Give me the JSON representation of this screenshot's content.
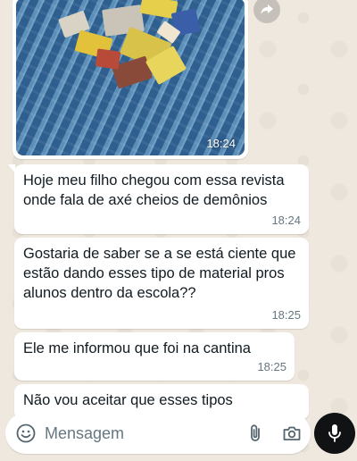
{
  "messages": [
    {
      "text": "Hoje meu filho chegou com essa revista onde fala de axé cheios de demônios",
      "time": "18:24"
    },
    {
      "text": "Gostaria de saber se a se está ciente que estão dando esses tipo de material pros alunos dentro da escola??",
      "time": "18:25"
    },
    {
      "text": "Ele me informou que foi na cantina",
      "time": "18:25"
    },
    {
      "text": "Não vou aceitar que esses tipos",
      "time": ""
    }
  ],
  "image_message": {
    "time": "18:24"
  },
  "composer": {
    "placeholder": "Mensagem"
  },
  "icons": {
    "forward": "forward-icon",
    "emoji": "emoji-icon",
    "attach": "paperclip-icon",
    "camera": "camera-icon",
    "mic": "microphone-icon"
  },
  "colors": {
    "background": "#efe8de",
    "bubble": "#ffffff",
    "mic_button": "#101214",
    "timestamp": "#667781"
  }
}
